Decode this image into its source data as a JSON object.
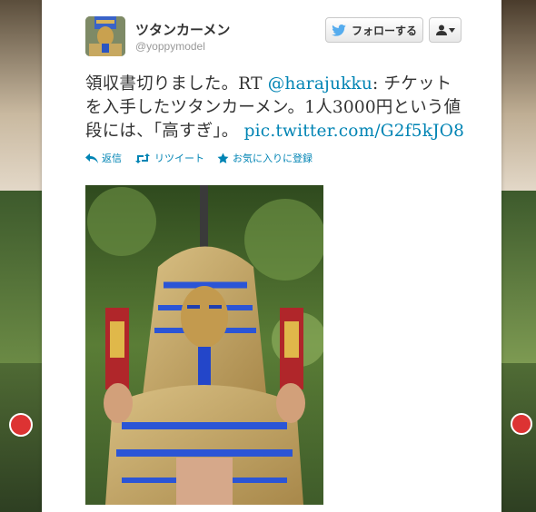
{
  "profile": {
    "display_name": "ツタンカーメン",
    "handle": "@yoppymodel"
  },
  "follow_button": {
    "label": "フォローする"
  },
  "tweet": {
    "text_before_mention": "領収書切りました。RT ",
    "mention": "@harajukku",
    "text_after_mention": ": チケットを入手したツタンカーメン。1人3000円という値段には、「高すぎ」。",
    "link": "pic.twitter.com/G2f5kJO8"
  },
  "actions": {
    "reply": "返信",
    "retweet": "リツイート",
    "favorite": "お気に入りに登録"
  },
  "colors": {
    "link": "#0084b4",
    "twitter_bird": "#55acee",
    "text": "#333333"
  },
  "icons": [
    "twitter-bird-icon",
    "user-icon",
    "caret-down-icon",
    "reply-icon",
    "retweet-icon",
    "star-icon"
  ]
}
